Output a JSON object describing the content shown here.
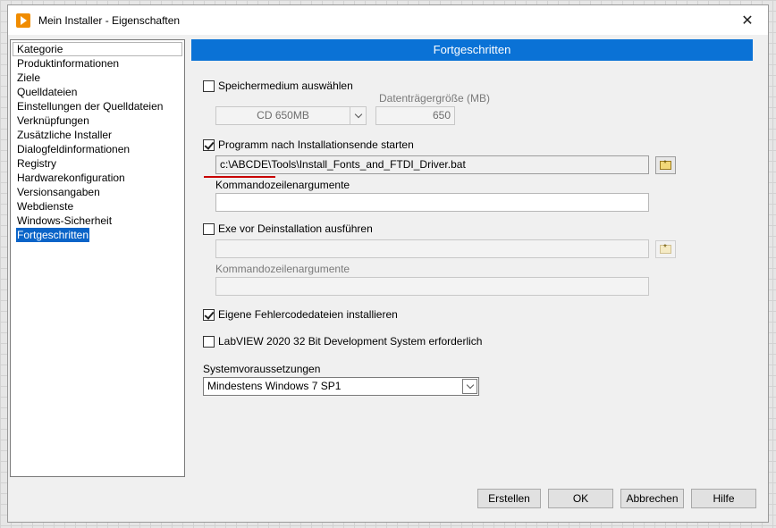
{
  "window": {
    "title": "Mein Installer - Eigenschaften",
    "close_glyph": "✕"
  },
  "sidebar": {
    "header": "Kategorie",
    "items": [
      "Produktinformationen",
      "Ziele",
      "Quelldateien",
      "Einstellungen der Quelldateien",
      "Verknüpfungen",
      "Zusätzliche Installer",
      "Dialogfeldinformationen",
      "Registry",
      "Hardwarekonfiguration",
      "Versionsangaben",
      "Webdienste",
      "Windows-Sicherheit",
      "Fortgeschritten"
    ],
    "selected_index": 12
  },
  "main": {
    "header": "Fortgeschritten",
    "storage": {
      "checkbox_label": "Speichermedium auswählen",
      "checked": false,
      "media_value": "CD 650MB",
      "size_label": "Datenträgergröße (MB)",
      "size_value": "650"
    },
    "run_after": {
      "checkbox_label": "Programm nach Installationsende starten",
      "checked": true,
      "path_value": "c:\\ABCDE\\Tools\\Install_Fonts_and_FTDI_Driver.bat",
      "args_label": "Kommandozeilenargumente",
      "args_value": ""
    },
    "run_before_uninstall": {
      "checkbox_label": "Exe vor Deinstallation ausführen",
      "checked": false,
      "path_value": "",
      "args_label": "Kommandozeilenargumente",
      "args_value": ""
    },
    "error_files": {
      "checkbox_label": "Eigene Fehlercodedateien installieren",
      "checked": true
    },
    "labview_required": {
      "checkbox_label": "LabVIEW 2020 32 Bit Development System erforderlich",
      "checked": false
    },
    "system_req": {
      "label": "Systemvoraussetzungen",
      "value": "Mindestens Windows 7 SP1"
    }
  },
  "buttons": {
    "build": "Erstellen",
    "ok": "OK",
    "cancel": "Abbrechen",
    "help": "Hilfe"
  },
  "colors": {
    "accent": "#0a72d6",
    "selection": "#0a64c8",
    "icon": "#f08c00",
    "annotation": "#c80000"
  }
}
